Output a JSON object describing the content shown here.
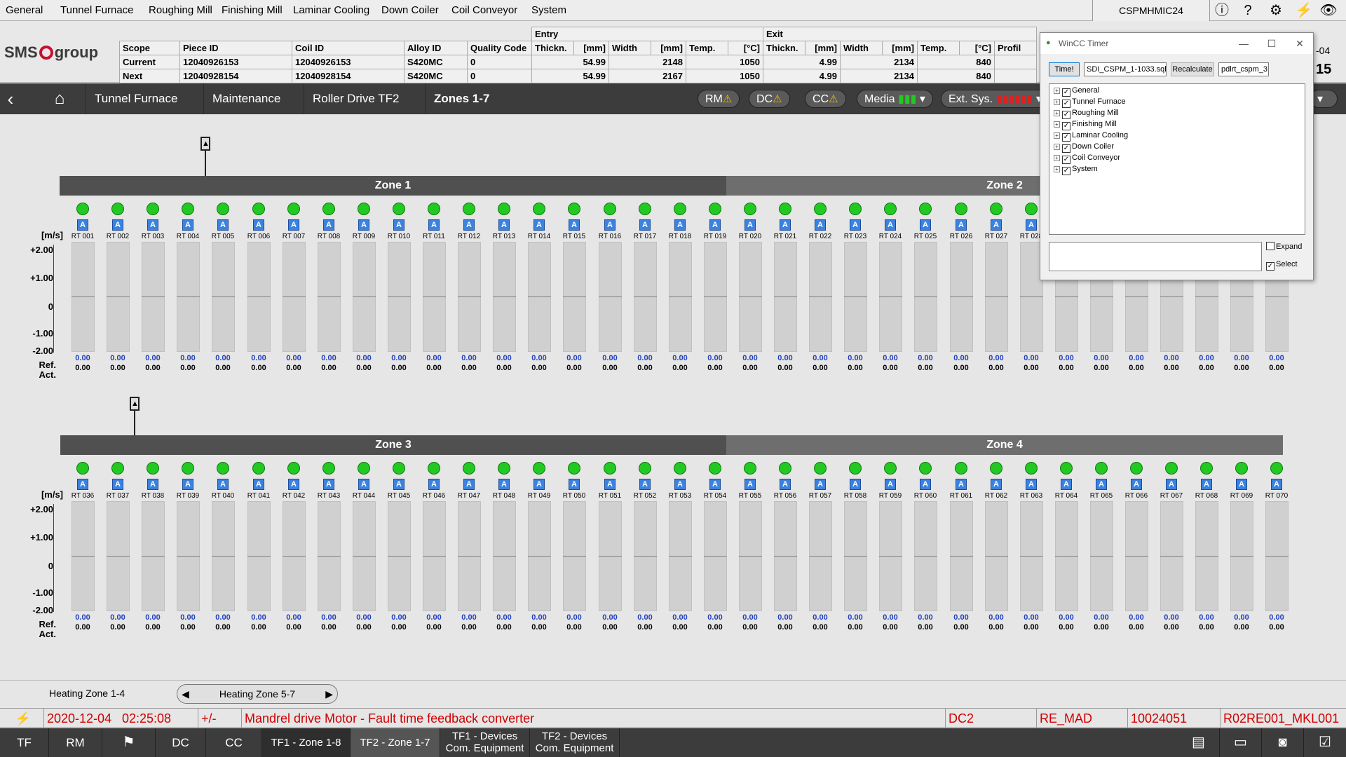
{
  "menu": [
    "General",
    "Tunnel Furnace",
    "Roughing Mill",
    "Finishing Mill",
    "Laminar Cooling",
    "Down Coiler",
    "Coil Conveyor",
    "System"
  ],
  "host": "CSPMHMIC24",
  "icons": {
    "info": "info-icon",
    "help": "help-icon",
    "settings": "gear-icon",
    "power": "lightning-icon",
    "view": "eye-icon"
  },
  "logo": {
    "left": "SMS",
    "right": "group"
  },
  "piece": {
    "headers": [
      "Scope",
      "Piece ID",
      "Coil ID",
      "Alloy ID",
      "Quality Code"
    ],
    "entry_label": "Entry",
    "exit_label": "Exit",
    "sub_headers": [
      "Thickn.",
      "[mm]",
      "Width",
      "[mm]",
      "Temp.",
      "[°C]",
      "Thickn.",
      "[mm]",
      "Width",
      "[mm]",
      "Temp.",
      "[°C]",
      "Profil"
    ],
    "rows": [
      {
        "scope": "Current",
        "piece": "12040926153",
        "coil": "12040926153",
        "alloy": "S420MC",
        "qc": "0",
        "e_thk": "54.99",
        "e_wid": "2148",
        "e_tmp": "1050",
        "x_thk": "4.99",
        "x_wid": "2134",
        "x_tmp": "840"
      },
      {
        "scope": "Next",
        "piece": "12040928154",
        "coil": "12040928154",
        "alloy": "S420MC",
        "qc": "0",
        "e_thk": "54.99",
        "e_wid": "2167",
        "e_tmp": "1050",
        "x_thk": "4.99",
        "x_wid": "2134",
        "x_tmp": "840"
      }
    ],
    "dc_label": "DC",
    "date_frag": "-04",
    "time_frag": "15"
  },
  "nav": {
    "crumbs": [
      "Tunnel Furnace",
      "Maintenance",
      "Roller Drive TF2",
      "Zones 1-7"
    ],
    "pills": [
      "RM",
      "DC",
      "CC",
      "Media",
      "Ext. Sys."
    ]
  },
  "panel1": {
    "zones": [
      "Zone 1",
      "Zone 2"
    ],
    "unit": "[m/s]",
    "yticks": [
      "+2.00",
      "+1.00",
      "0",
      "-1.00",
      "-2.00"
    ],
    "row_ref": "Ref.",
    "row_act": "Act.",
    "start": 1,
    "count": 35,
    "value": "0.00"
  },
  "panel2": {
    "zones": [
      "Zone 3",
      "Zone 4"
    ],
    "unit": "[m/s]",
    "yticks": [
      "+2.00",
      "+1.00",
      "0",
      "-1.00",
      "-2.00"
    ],
    "row_ref": "Ref.",
    "row_act": "Act.",
    "start": 36,
    "count": 35,
    "value": "0.00"
  },
  "pager": {
    "prev": "Heating Zone 1-4",
    "current": "Heating Zone 5-7"
  },
  "alarm": {
    "date": "2020-12-04",
    "time": "02:25:08",
    "sign": "+/-",
    "text": "Mandrel drive Motor - Fault time feedback converter",
    "area": "DC2",
    "user": "RE_MAD",
    "code": "10024051",
    "tag": "R02RE001_MKL001"
  },
  "taskbar": {
    "tf": "TF",
    "rm": "RM",
    "dc": "DC",
    "cc": "CC",
    "tabs": [
      "TF1 -  Zone 1-8",
      "TF2 -  Zone 1-7"
    ],
    "dev1": [
      "TF1 - Devices",
      "Com. Equipment"
    ],
    "dev2": [
      "TF2 - Devices",
      "Com. Equipment"
    ]
  },
  "dialog": {
    "title": "WinCC Timer",
    "time_btn": "Time!",
    "file": "SDI_CSPM_1-1033.sql",
    "recalc": "Recalculate",
    "db": "pdlrt_cspm_3",
    "tree": [
      "General",
      "Tunnel Furnace",
      "Roughing Mill",
      "Finishing Mill",
      "Laminar Cooling",
      "Down Coiler",
      "Coil Conveyor",
      "System"
    ],
    "expand": "Expand",
    "select": "Select"
  }
}
